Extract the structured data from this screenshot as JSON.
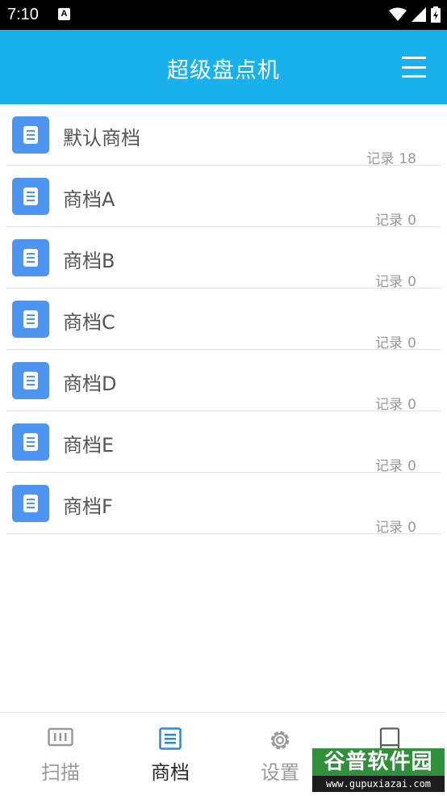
{
  "status_bar": {
    "time": "7:10",
    "notification_icon": "A"
  },
  "app_bar": {
    "title": "超级盘点机",
    "menu_icon": "hamburger-menu-icon"
  },
  "list": {
    "items": [
      {
        "name": "默认商档",
        "record_label": "记录",
        "record_count": "18"
      },
      {
        "name": "商档A",
        "record_label": "记录",
        "record_count": "0"
      },
      {
        "name": "商档B",
        "record_label": "记录",
        "record_count": "0"
      },
      {
        "name": "商档C",
        "record_label": "记录",
        "record_count": "0"
      },
      {
        "name": "商档D",
        "record_label": "记录",
        "record_count": "0"
      },
      {
        "name": "商档E",
        "record_label": "记录",
        "record_count": "0"
      },
      {
        "name": "商档F",
        "record_label": "记录",
        "record_count": "0"
      }
    ]
  },
  "tabs": [
    {
      "label": "扫描",
      "icon": "barcode-icon",
      "active": false
    },
    {
      "label": "商档",
      "icon": "document-list-icon",
      "active": true
    },
    {
      "label": "设置",
      "icon": "gear-icon",
      "active": false
    },
    {
      "label": "",
      "icon": "book-icon",
      "active": false
    }
  ],
  "watermark": {
    "main": "谷普软件园",
    "sub": "www.gupuxiazai.com"
  },
  "colors": {
    "app_bar": "#19b1ec",
    "item_icon": "#4d95f0",
    "active_tab": "#2e86de",
    "inactive_tab": "#9a9a9a"
  }
}
